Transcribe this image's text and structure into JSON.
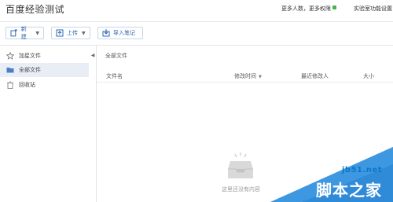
{
  "header": {
    "app_title": "百度经验测试",
    "more_users": "更多人数，更多权限",
    "lab_settings": "实验室功能设置"
  },
  "toolbar": {
    "new_label": "新建",
    "upload_label": "上传",
    "import_label": "导入笔记"
  },
  "sidebar": {
    "items": [
      {
        "label": "加星文件",
        "icon": "star-icon"
      },
      {
        "label": "全部文件",
        "icon": "folder-icon",
        "active": true
      },
      {
        "label": "回收站",
        "icon": "trash-icon"
      }
    ]
  },
  "main": {
    "breadcrumb": "全部文件",
    "columns": [
      "文件名",
      "修改时间",
      "最近修改人",
      "大小"
    ],
    "empty_text": "这里还没有内容"
  },
  "watermark": {
    "url": "jb51.net",
    "name": "脚本之家"
  },
  "colors": {
    "accent": "#2d67b2",
    "active_bg": "#e9eef6",
    "badge_green": "#46b449",
    "watermark_blue": "#0a77c9"
  }
}
